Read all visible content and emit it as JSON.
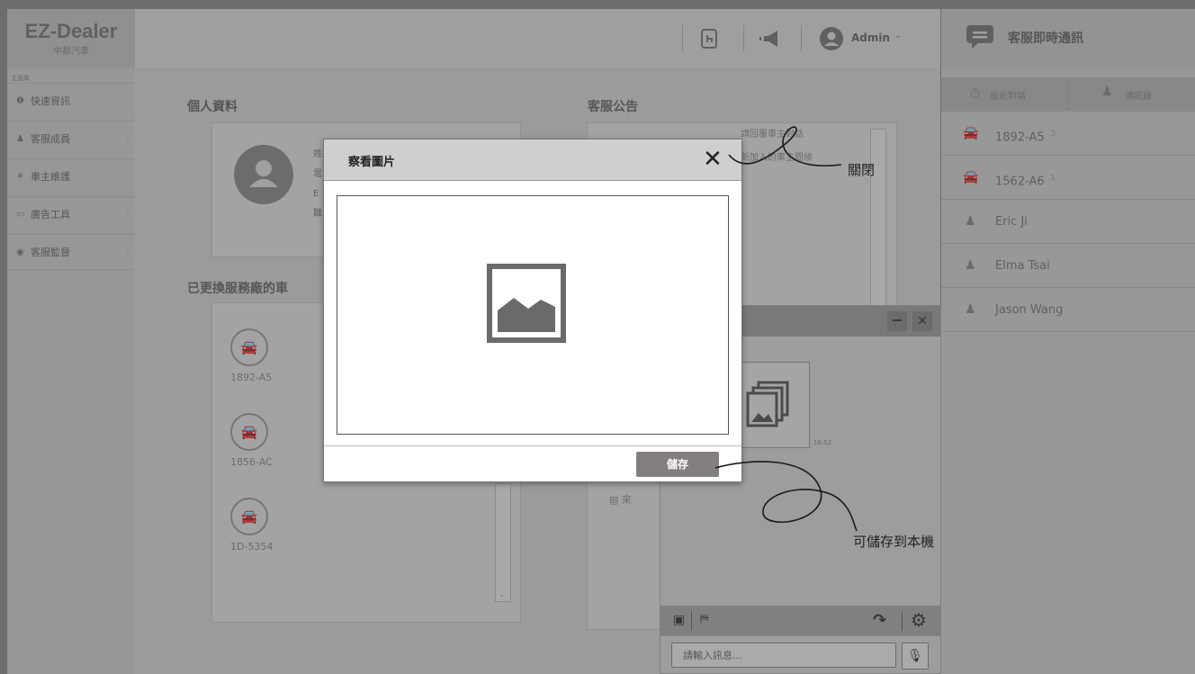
{
  "brand": {
    "name": "EZ-Dealer",
    "subtitle": "中都汽車"
  },
  "sidebar": {
    "caption": "主選單",
    "items": [
      {
        "label": "快速資訊",
        "icon": "info-icon",
        "glyph": "❶"
      },
      {
        "label": "客服成員",
        "icon": "person-icon",
        "glyph": "♟"
      },
      {
        "label": "車主維護",
        "icon": "car-icon",
        "glyph": "⚘"
      },
      {
        "label": "廣告工具",
        "icon": "monitor-icon",
        "glyph": "▭"
      },
      {
        "label": "客服監督",
        "icon": "eye-icon",
        "glyph": "◉"
      }
    ]
  },
  "topbar": {
    "admin_label": "Admin"
  },
  "profile": {
    "title": "個人資料",
    "field_initials": [
      "姓",
      "電",
      "E",
      "職"
    ]
  },
  "vehicles": {
    "title": "已更換服務廠的車",
    "plates": [
      "1892-A5",
      "1856-AC",
      "1D-5354"
    ]
  },
  "announce": {
    "title": "客服公告",
    "items": [
      "請回覆車主對話",
      "新加入的車主問候"
    ],
    "bottom_item": "來"
  },
  "chat_panel": {
    "title": "客服即時通訊",
    "tabs": [
      "最近對話",
      "通訊錄"
    ],
    "contacts": [
      {
        "name": "1892-A5",
        "badge": "3",
        "type": "car"
      },
      {
        "name": "1562-A6",
        "badge": "1",
        "type": "car"
      },
      {
        "name": "Eric Ji",
        "badge": "",
        "type": "person"
      },
      {
        "name": "Elma Tsai",
        "badge": "",
        "type": "person"
      },
      {
        "name": "Jason Wang",
        "badge": "",
        "type": "person"
      }
    ]
  },
  "chat_window": {
    "timestamp": "16:52",
    "input_placeholder": "請輸入訊息..."
  },
  "modal": {
    "title": "察看圖片",
    "save_label": "儲存"
  },
  "annotations": {
    "close_note": "關閉",
    "save_note": "可儲存到本機"
  },
  "colors": {
    "overlay": "#3c3c3c",
    "save_button": "#837f7e"
  }
}
